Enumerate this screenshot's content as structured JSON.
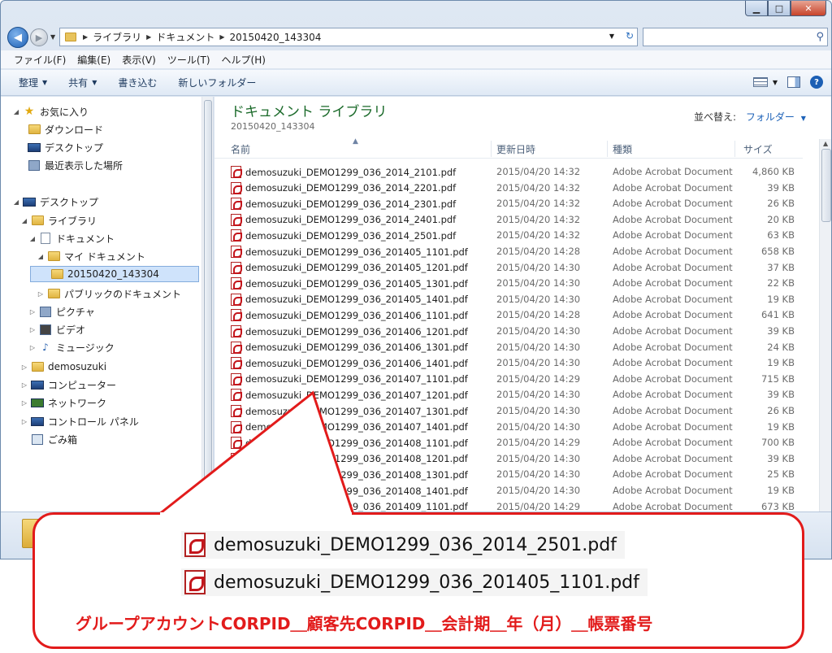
{
  "address": {
    "crumbs": [
      "ライブラリ",
      "ドキュメント",
      "20150420_143304"
    ]
  },
  "menu": [
    "ファイル(F)",
    "編集(E)",
    "表示(V)",
    "ツール(T)",
    "ヘルプ(H)"
  ],
  "toolbar": {
    "organize": "整理",
    "share": "共有",
    "burn": "書き込む",
    "new_folder": "新しいフォルダー"
  },
  "nav": {
    "favorites": "お気に入り",
    "downloads": "ダウンロード",
    "desktop_fav": "デスクトップ",
    "recent": "最近表示した場所",
    "desktop": "デスクトップ",
    "libraries": "ライブラリ",
    "documents": "ドキュメント",
    "my_documents": "マイ ドキュメント",
    "current_folder": "20150420_143304",
    "public_documents": "パブリックのドキュメント",
    "pictures": "ピクチャ",
    "videos": "ビデオ",
    "music": "ミュージック",
    "user": "demosuzuki",
    "computer": "コンピューター",
    "network": "ネットワーク",
    "control_panel": "コントロール パネル",
    "recycle_bin": "ごみ箱"
  },
  "content": {
    "title": "ドキュメント ライブラリ",
    "subtitle": "20150420_143304",
    "arrange_label": "並べ替え:",
    "arrange_value": "フォルダー",
    "columns": {
      "name": "名前",
      "date": "更新日時",
      "type": "種類",
      "size": "サイズ"
    },
    "files": [
      {
        "name": "demosuzuki_DEMO1299_036_2014_2101.pdf",
        "date": "2015/04/20 14:32",
        "type": "Adobe Acrobat Document",
        "size": "4,860 KB"
      },
      {
        "name": "demosuzuki_DEMO1299_036_2014_2201.pdf",
        "date": "2015/04/20 14:32",
        "type": "Adobe Acrobat Document",
        "size": "39 KB"
      },
      {
        "name": "demosuzuki_DEMO1299_036_2014_2301.pdf",
        "date": "2015/04/20 14:32",
        "type": "Adobe Acrobat Document",
        "size": "26 KB"
      },
      {
        "name": "demosuzuki_DEMO1299_036_2014_2401.pdf",
        "date": "2015/04/20 14:32",
        "type": "Adobe Acrobat Document",
        "size": "20 KB"
      },
      {
        "name": "demosuzuki_DEMO1299_036_2014_2501.pdf",
        "date": "2015/04/20 14:32",
        "type": "Adobe Acrobat Document",
        "size": "63 KB"
      },
      {
        "name": "demosuzuki_DEMO1299_036_201405_1101.pdf",
        "date": "2015/04/20 14:28",
        "type": "Adobe Acrobat Document",
        "size": "658 KB"
      },
      {
        "name": "demosuzuki_DEMO1299_036_201405_1201.pdf",
        "date": "2015/04/20 14:30",
        "type": "Adobe Acrobat Document",
        "size": "37 KB"
      },
      {
        "name": "demosuzuki_DEMO1299_036_201405_1301.pdf",
        "date": "2015/04/20 14:30",
        "type": "Adobe Acrobat Document",
        "size": "22 KB"
      },
      {
        "name": "demosuzuki_DEMO1299_036_201405_1401.pdf",
        "date": "2015/04/20 14:30",
        "type": "Adobe Acrobat Document",
        "size": "19 KB"
      },
      {
        "name": "demosuzuki_DEMO1299_036_201406_1101.pdf",
        "date": "2015/04/20 14:28",
        "type": "Adobe Acrobat Document",
        "size": "641 KB"
      },
      {
        "name": "demosuzuki_DEMO1299_036_201406_1201.pdf",
        "date": "2015/04/20 14:30",
        "type": "Adobe Acrobat Document",
        "size": "39 KB"
      },
      {
        "name": "demosuzuki_DEMO1299_036_201406_1301.pdf",
        "date": "2015/04/20 14:30",
        "type": "Adobe Acrobat Document",
        "size": "24 KB"
      },
      {
        "name": "demosuzuki_DEMO1299_036_201406_1401.pdf",
        "date": "2015/04/20 14:30",
        "type": "Adobe Acrobat Document",
        "size": "19 KB"
      },
      {
        "name": "demosuzuki_DEMO1299_036_201407_1101.pdf",
        "date": "2015/04/20 14:29",
        "type": "Adobe Acrobat Document",
        "size": "715 KB"
      },
      {
        "name": "demosuzuki_DEMO1299_036_201407_1201.pdf",
        "date": "2015/04/20 14:30",
        "type": "Adobe Acrobat Document",
        "size": "39 KB"
      },
      {
        "name": "demosuzuki_DEMO1299_036_201407_1301.pdf",
        "date": "2015/04/20 14:30",
        "type": "Adobe Acrobat Document",
        "size": "26 KB"
      },
      {
        "name": "demosuzuki_DEMO1299_036_201407_1401.pdf",
        "date": "2015/04/20 14:30",
        "type": "Adobe Acrobat Document",
        "size": "19 KB"
      },
      {
        "name": "demosuzuki_DEMO1299_036_201408_1101.pdf",
        "date": "2015/04/20 14:29",
        "type": "Adobe Acrobat Document",
        "size": "700 KB"
      },
      {
        "name": "demosuzuki_DEMO1299_036_201408_1201.pdf",
        "date": "2015/04/20 14:30",
        "type": "Adobe Acrobat Document",
        "size": "39 KB"
      },
      {
        "name": "demosuzuki_DEMO1299_036_201408_1301.pdf",
        "date": "2015/04/20 14:30",
        "type": "Adobe Acrobat Document",
        "size": "25 KB"
      },
      {
        "name": "demosuzuki_DEMO1299_036_201408_1401.pdf",
        "date": "2015/04/20 14:30",
        "type": "Adobe Acrobat Document",
        "size": "19 KB"
      },
      {
        "name": "demosuzuki_DEMO1299_036_201409_1101.pdf",
        "date": "2015/04/20 14:29",
        "type": "Adobe Acrobat Document",
        "size": "673 KB"
      }
    ]
  },
  "callout": {
    "file1": "demosuzuki_DEMO1299_036_2014_2501.pdf",
    "file2": "demosuzuki_DEMO1299_036_201405_1101.pdf",
    "caption": "グループアカウントCORPID＿顧客先CORPID＿会計期＿年（月）＿帳票番号"
  },
  "colors": {
    "callout_red": "#e21b1b",
    "library_green": "#1b6a2a",
    "link_blue": "#1d62b8"
  },
  "icons": [
    "back-icon",
    "forward-icon",
    "folder-icon",
    "refresh-icon",
    "search-icon",
    "pdf-icon",
    "star-icon",
    "help-icon"
  ]
}
